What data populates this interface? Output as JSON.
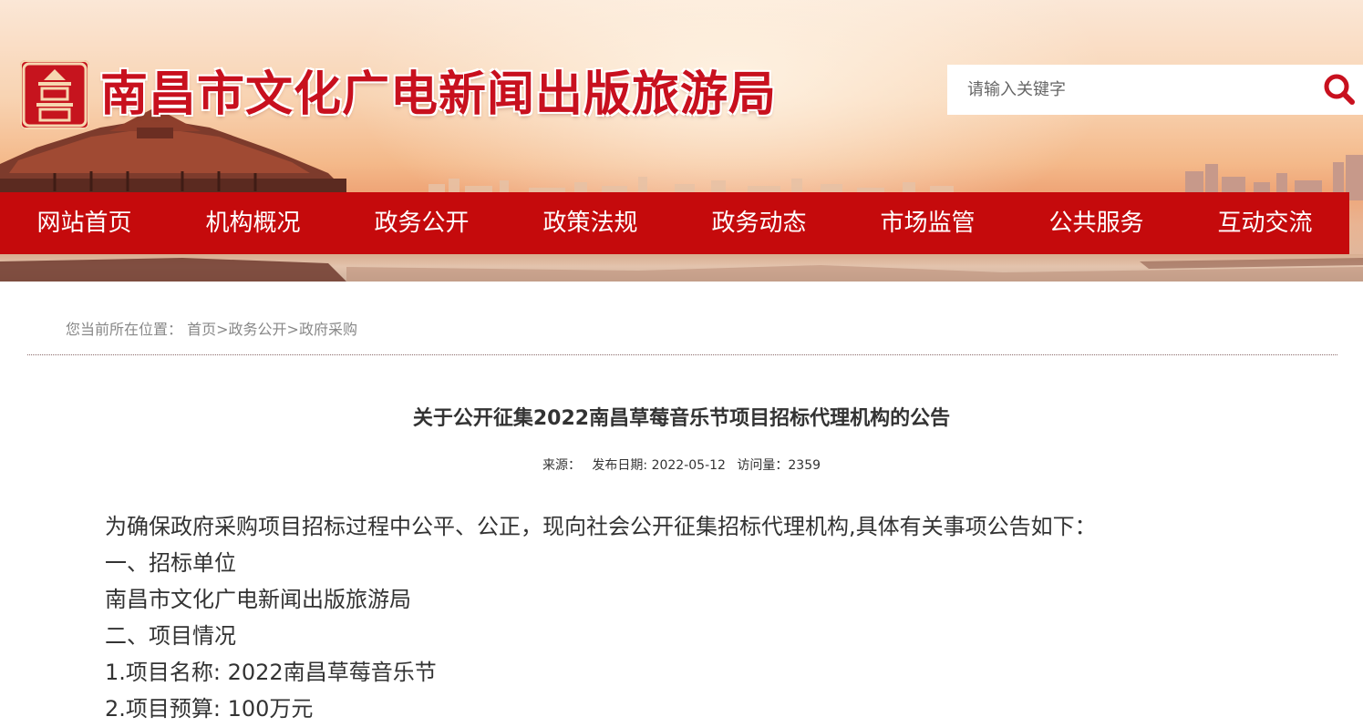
{
  "header": {
    "site_title": "南昌市文化广电新闻出版旅游局",
    "search_placeholder": "请输入关键字",
    "logo_text": "南昌"
  },
  "nav": {
    "items": [
      "网站首页",
      "机构概况",
      "政务公开",
      "政策法规",
      "政务动态",
      "市场监管",
      "公共服务",
      "互动交流"
    ]
  },
  "breadcrumb": {
    "label": "您当前所在位置：",
    "items": [
      "首页",
      "政务公开",
      "政府采购"
    ],
    "separator": ">"
  },
  "article": {
    "title": "关于公开征集2022南昌草莓音乐节项目招标代理机构的公告",
    "meta": {
      "source_label": "来源：",
      "date_label": "发布日期: 2022-05-12",
      "views_label": "访问量：2359"
    },
    "paragraphs": [
      "为确保政府采购项目招标过程中公平、公正，现向社会公开征集招标代理机构,具体有关事项公告如下：",
      "一、招标单位",
      "南昌市文化广电新闻出版旅游局",
      "二、项目情况",
      "1.项目名称: 2022南昌草莓音乐节",
      "2.项目预算: 100万元"
    ]
  },
  "colors": {
    "nav_red": "#c50a0c",
    "title_red": "#c8101e",
    "text": "#333333",
    "muted": "#888888"
  }
}
